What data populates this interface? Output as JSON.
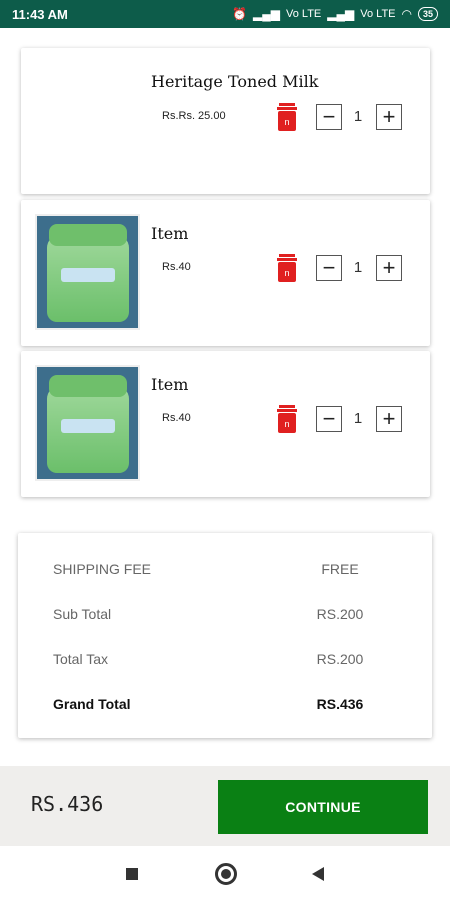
{
  "status_bar": {
    "time": "11:43 AM",
    "network_label_1": "Vo LTE",
    "network_label_2": "Vo LTE",
    "battery": "35",
    "icons": [
      "alarm-off-icon",
      "signal-icon",
      "signal-icon",
      "wifi-icon",
      "battery-icon"
    ]
  },
  "cart_items": [
    {
      "name": "Heritage Toned Milk",
      "price": "Rs.Rs. 25.00",
      "quantity": "1",
      "has_image": false
    },
    {
      "name": "Item",
      "price": "Rs.40",
      "quantity": "1",
      "has_image": true
    },
    {
      "name": "Item",
      "price": "Rs.40",
      "quantity": "1",
      "has_image": true
    }
  ],
  "controls": {
    "minus": "−",
    "plus": "+"
  },
  "summary": {
    "shipping_label": "SHIPPING FEE",
    "shipping_value": "FREE",
    "subtotal_label": "Sub Total",
    "subtotal_value": "RS.200",
    "tax_label": "Total Tax",
    "tax_value": "RS.200",
    "grand_total_label": "Grand Total",
    "grand_total_value": "RS.436"
  },
  "footer": {
    "total": "RS.436",
    "continue_label": "CONTINUE"
  },
  "colors": {
    "status_bar": "#0d5c4a",
    "continue_button": "#0a8014",
    "delete_icon": "#e02020"
  }
}
